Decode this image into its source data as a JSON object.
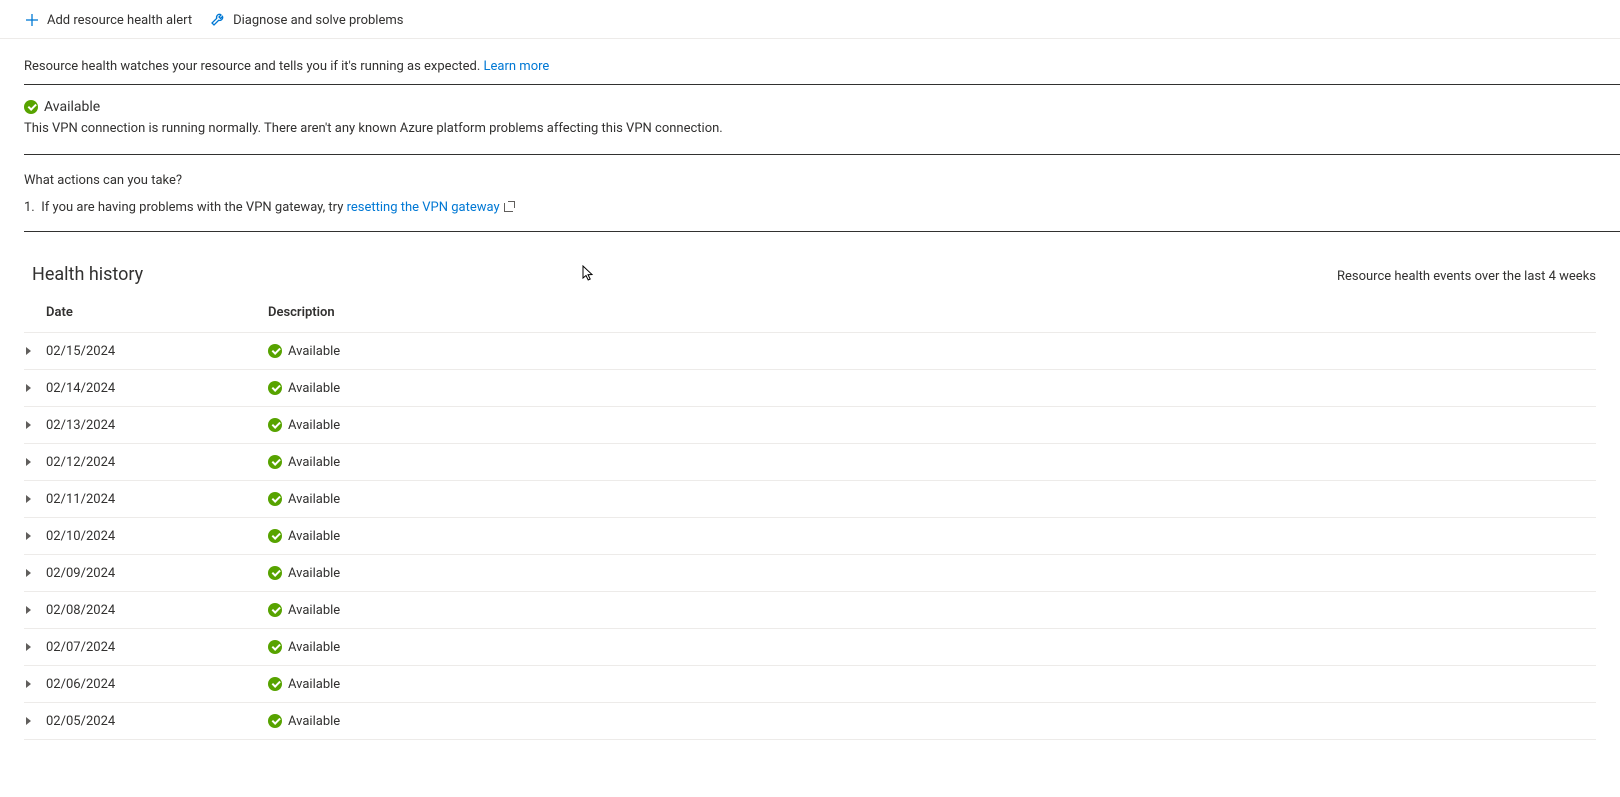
{
  "toolbar": {
    "add_alert": "Add resource health alert",
    "diagnose": "Diagnose and solve problems"
  },
  "intro": {
    "text": "Resource health watches your resource and tells you if it's running as expected.",
    "learn_more": "Learn more"
  },
  "status": {
    "label": "Available",
    "description": "This VPN connection is running normally. There aren't any known Azure platform problems affecting this VPN connection."
  },
  "actions": {
    "title": "What actions can you take?",
    "items": [
      {
        "num": "1.",
        "prefix": "If you are having problems with the VPN gateway, try ",
        "link_text": "resetting the VPN gateway"
      }
    ]
  },
  "history": {
    "title": "Health history",
    "subtitle": "Resource health events over the last 4 weeks",
    "columns": {
      "date": "Date",
      "description": "Description"
    },
    "rows": [
      {
        "date": "02/15/2024",
        "status": "Available"
      },
      {
        "date": "02/14/2024",
        "status": "Available"
      },
      {
        "date": "02/13/2024",
        "status": "Available"
      },
      {
        "date": "02/12/2024",
        "status": "Available"
      },
      {
        "date": "02/11/2024",
        "status": "Available"
      },
      {
        "date": "02/10/2024",
        "status": "Available"
      },
      {
        "date": "02/09/2024",
        "status": "Available"
      },
      {
        "date": "02/08/2024",
        "status": "Available"
      },
      {
        "date": "02/07/2024",
        "status": "Available"
      },
      {
        "date": "02/06/2024",
        "status": "Available"
      },
      {
        "date": "02/05/2024",
        "status": "Available"
      }
    ]
  }
}
